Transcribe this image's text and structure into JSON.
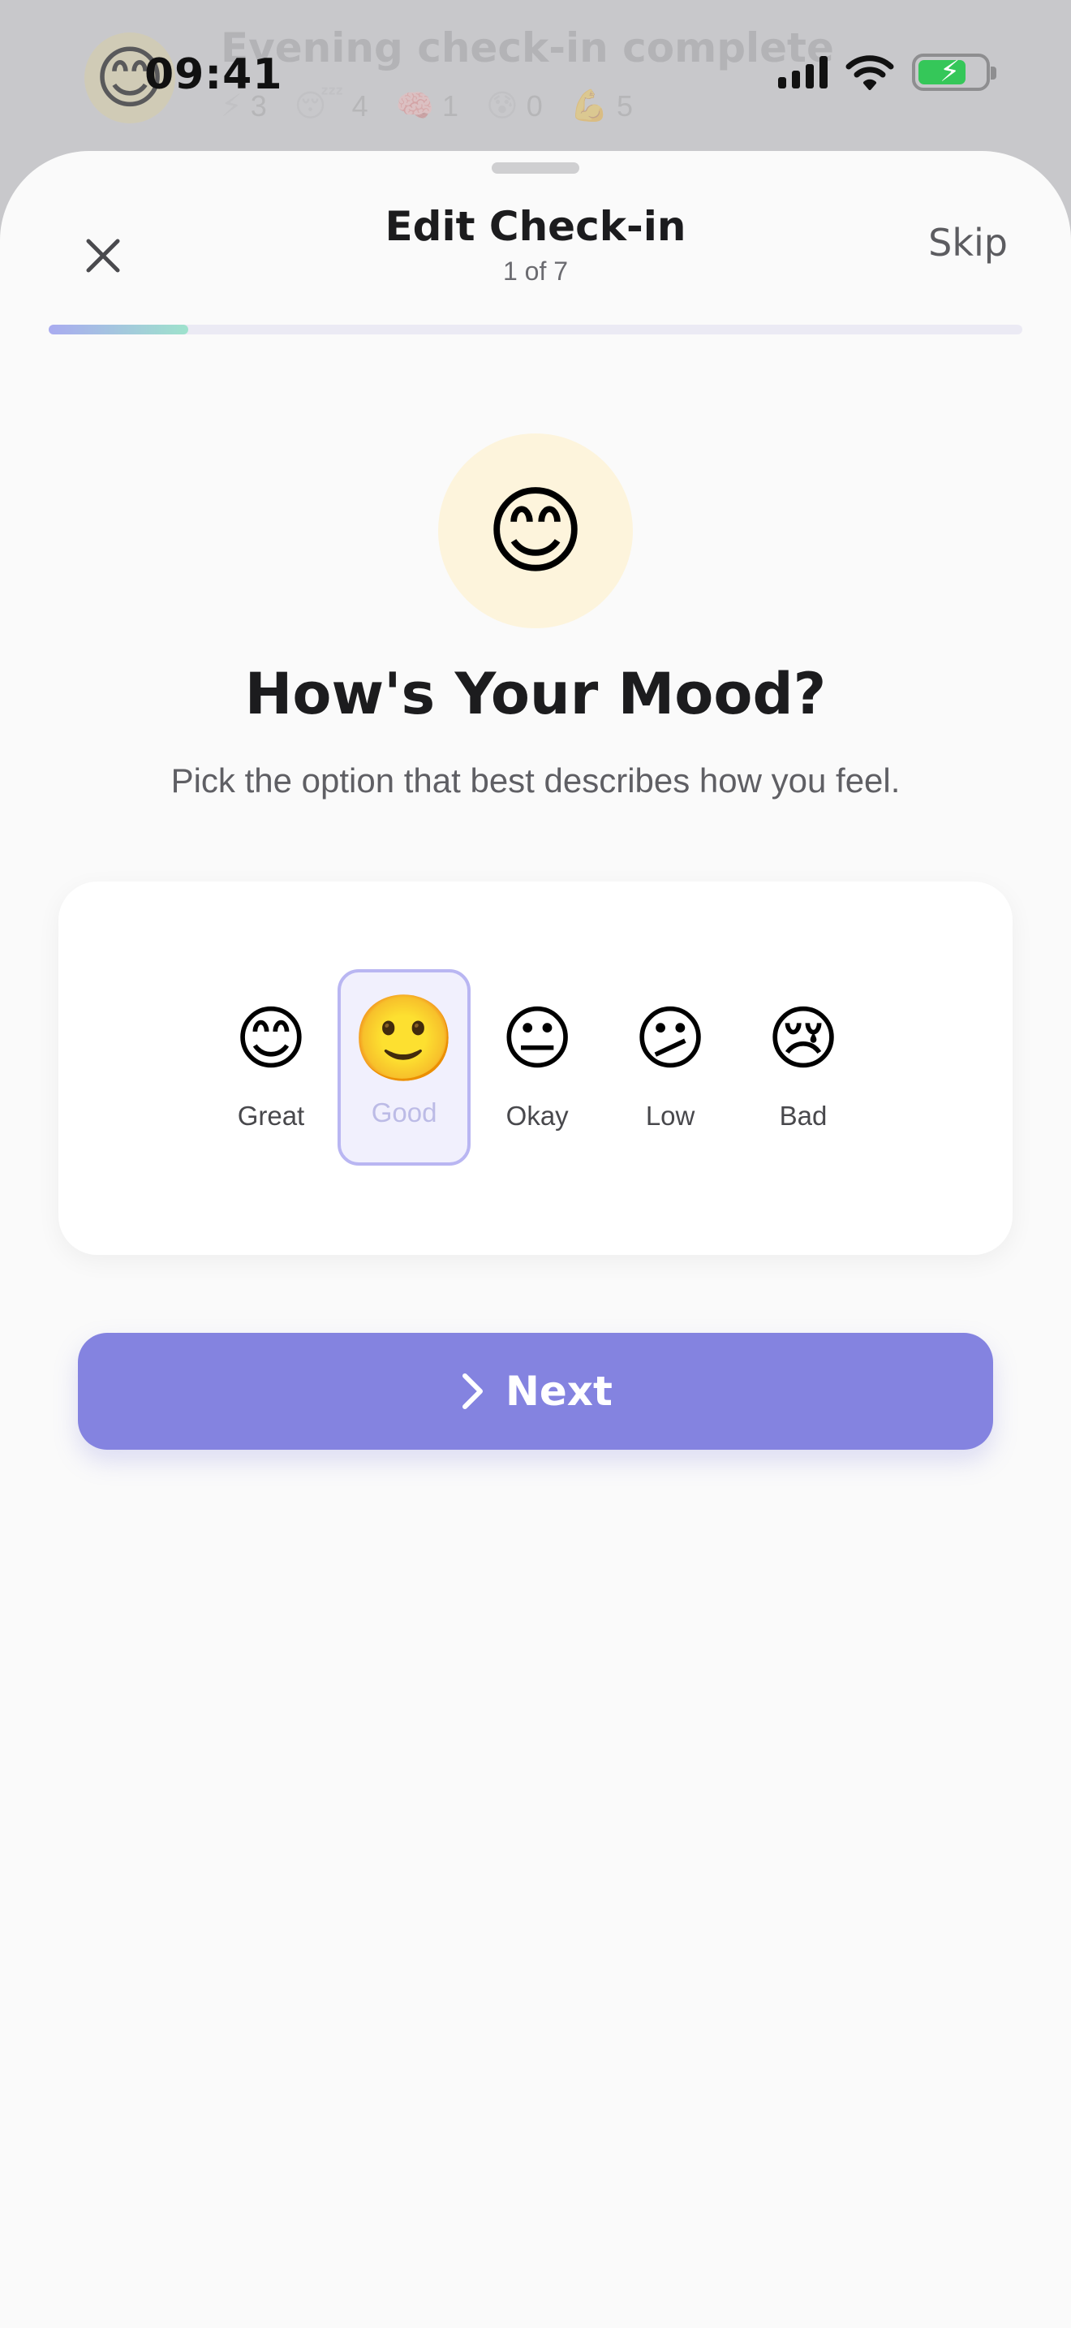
{
  "background_card": {
    "avatar_emoji": "😊",
    "title": "Evening check-in complete",
    "stats": [
      {
        "icon": "⚡",
        "icon_name": "lightning-icon",
        "value": "3"
      },
      {
        "icon": "😴",
        "icon_name": "sleep-face-icon",
        "value": "4"
      },
      {
        "icon": "🧠",
        "icon_name": "brain-icon",
        "value": "1"
      },
      {
        "icon": "😰",
        "icon_name": "anxious-face-icon",
        "value": "0"
      },
      {
        "icon": "💪",
        "icon_name": "flexed-biceps-icon",
        "value": "5"
      }
    ]
  },
  "status_bar": {
    "time": "09:41",
    "battery_level": 0.72,
    "battery_color": "#35c759"
  },
  "sheet": {
    "title": "Edit Check-in",
    "step_text": "1 of 7",
    "close_icon": "close-icon",
    "skip_label": "Skip",
    "progress": 0.143
  },
  "question": {
    "hero_emoji": "😊",
    "title": "How's Your Mood?",
    "helper": "Pick the option that best describes how you feel."
  },
  "mood_options": [
    {
      "emoji": "😊",
      "label": "Great",
      "selected": false
    },
    {
      "emoji": "🙂",
      "label": "Good",
      "selected": true
    },
    {
      "emoji": "😐",
      "label": "Okay",
      "selected": false
    },
    {
      "emoji": "😕",
      "label": "Low",
      "selected": false
    },
    {
      "emoji": "😢",
      "label": "Bad",
      "selected": false
    }
  ],
  "next_button": {
    "label": "Next",
    "icon": "chevron-right-icon",
    "color": "#8483e0"
  },
  "colors": {
    "accent": "#8483e0",
    "selected_border": "#b9b6f2",
    "hero_bg": "#fdf4dc"
  }
}
